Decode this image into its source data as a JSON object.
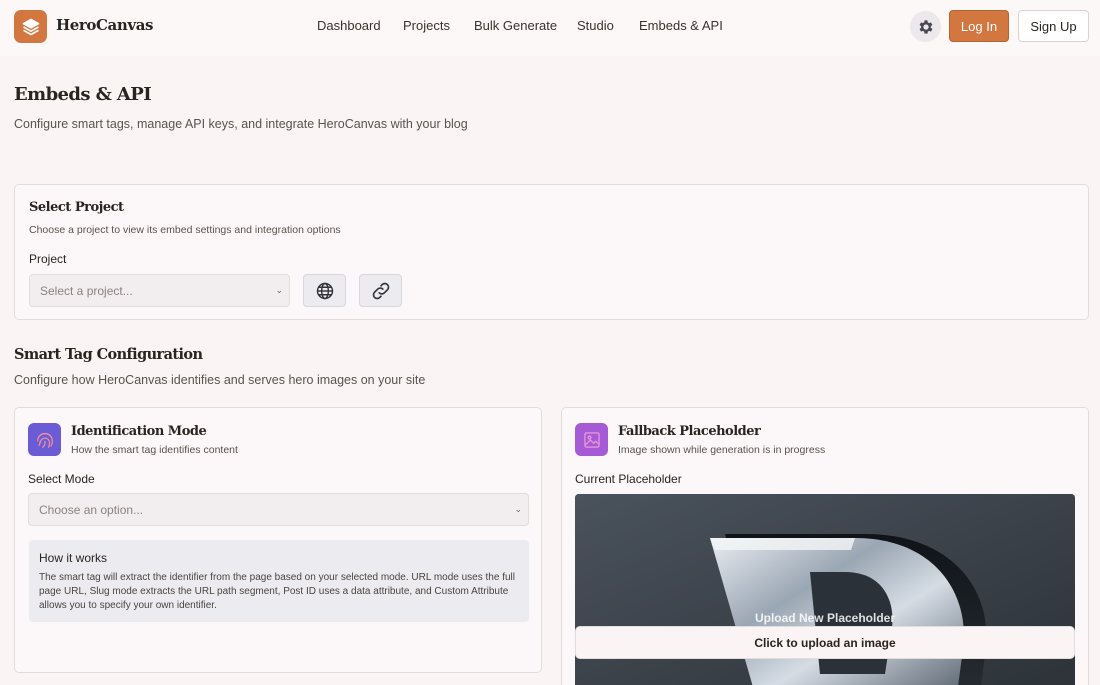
{
  "header": {
    "brand": "HeroCanvas",
    "nav": [
      "Dashboard",
      "Projects",
      "Bulk Generate",
      "Studio",
      "Embeds & API"
    ],
    "login_label": "Log In",
    "signup_label": "Sign Up",
    "icons": {
      "logo": "layers-icon",
      "settings": "gear-icon"
    }
  },
  "page": {
    "title": "Embeds & API",
    "subtitle": "Configure smart tags, manage API keys, and integrate HeroCanvas with your blog"
  },
  "select_project": {
    "title": "Select Project",
    "subtitle": "Choose a project to view its embed settings and integration options",
    "field_label": "Project",
    "placeholder": "Select a project...",
    "icons": [
      "globe-icon",
      "link-icon"
    ]
  },
  "smart_tag": {
    "title": "Smart Tag Configuration",
    "subtitle": "Configure how HeroCanvas identifies and serves hero images on your site"
  },
  "identification": {
    "title": "Identification Mode",
    "subtitle": "How the smart tag identifies content",
    "field_label": "Select Mode",
    "placeholder": "Choose an option...",
    "how_title": "How it works",
    "how_text": "The smart tag will extract the identifier from the page based on your selected mode. URL mode uses the full page URL, Slug mode extracts the URL path segment, Post ID uses a data attribute, and Custom Attribute allows you to specify your own identifier.",
    "icon": "fingerprint-icon"
  },
  "fallback": {
    "title": "Fallback Placeholder",
    "subtitle": "Image shown while generation is in progress",
    "field_label": "Current Placeholder",
    "upload_overlay": "Upload New Placeholder",
    "upload_button": "Click to upload an image",
    "icon": "image-icon"
  },
  "colors": {
    "accent": "#d2773f",
    "background": "#faf5f4",
    "identification_tile": "#6b5cd6",
    "fallback_tile": "#a55ad6"
  }
}
